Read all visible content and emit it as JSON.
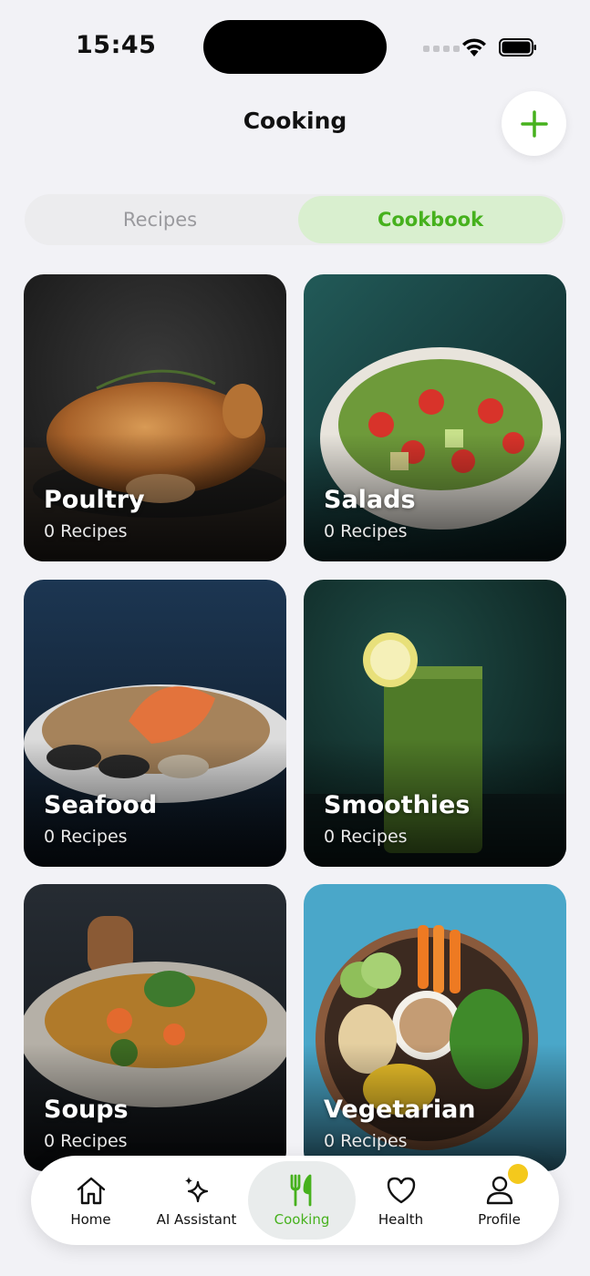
{
  "status": {
    "time": "15:45"
  },
  "header": {
    "title": "Cooking",
    "add_icon": "plus-icon"
  },
  "tabs": [
    {
      "label": "Recipes",
      "active": false
    },
    {
      "label": "Cookbook",
      "active": true
    }
  ],
  "categories": [
    {
      "title": "Poultry",
      "count": "0 Recipes"
    },
    {
      "title": "Salads",
      "count": "0 Recipes"
    },
    {
      "title": "Seafood",
      "count": "0 Recipes"
    },
    {
      "title": "Smoothies",
      "count": "0 Recipes"
    },
    {
      "title": "Soups",
      "count": "0 Recipes"
    },
    {
      "title": "Vegetarian",
      "count": "0 Recipes"
    }
  ],
  "nav": [
    {
      "label": "Home",
      "icon": "home-icon"
    },
    {
      "label": "AI Assistant",
      "icon": "sparkle-icon"
    },
    {
      "label": "Cooking",
      "icon": "utensils-icon",
      "active": true
    },
    {
      "label": "Health",
      "icon": "heart-icon"
    },
    {
      "label": "Profile",
      "icon": "user-icon"
    }
  ],
  "colors": {
    "accent": "#46b11d",
    "accent_bg": "#d9efcf",
    "badge": "#f4c91c"
  }
}
